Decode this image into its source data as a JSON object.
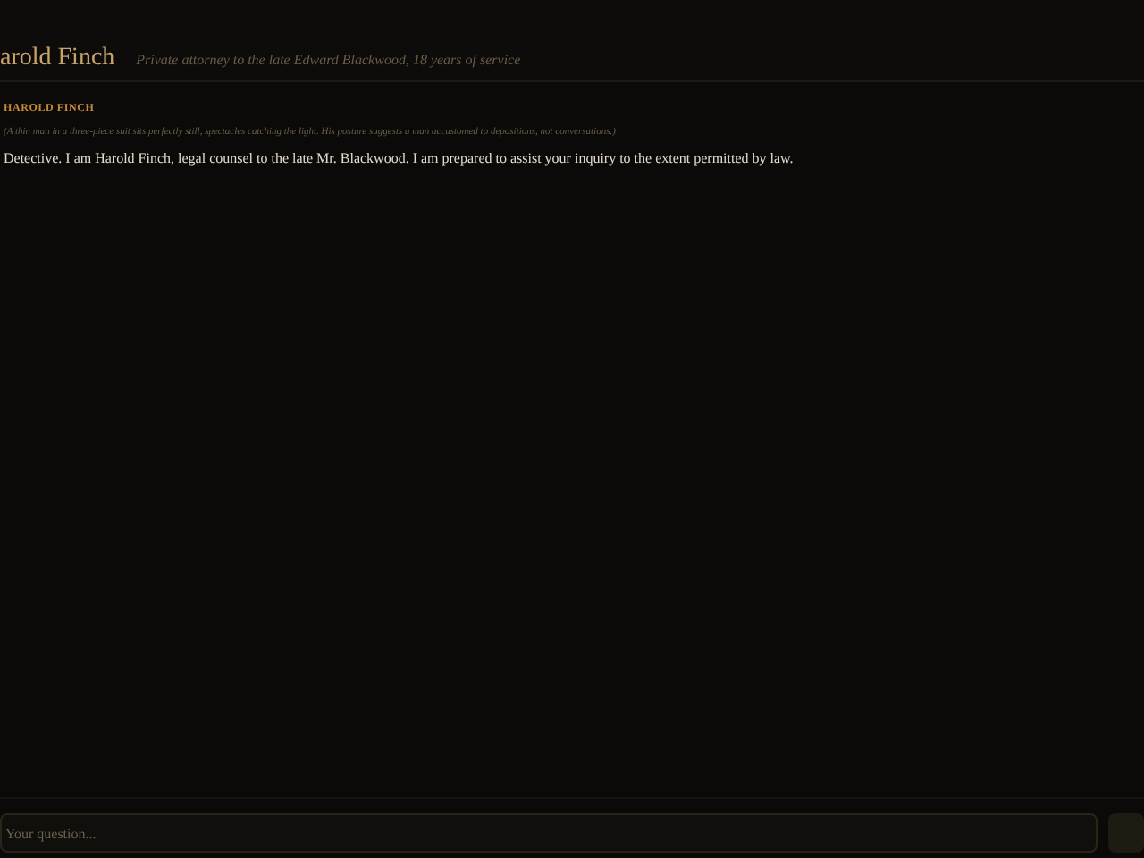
{
  "header": {
    "name": "arold Finch",
    "subtitle": "Private attorney to the late Edward Blackwood, 18 years of service"
  },
  "messages": [
    {
      "speaker": "HAROLD FINCH",
      "action": "(A thin man in a three-piece suit sits perfectly still, spectacles catching the light. His posture suggests a man accustomed to depositions, not conversations.)",
      "text": "Detective. I am Harold Finch, legal counsel to the late Mr. Blackwood. I am prepared to assist your inquiry to the extent permitted by law."
    }
  ],
  "input": {
    "placeholder": "Your question..."
  }
}
